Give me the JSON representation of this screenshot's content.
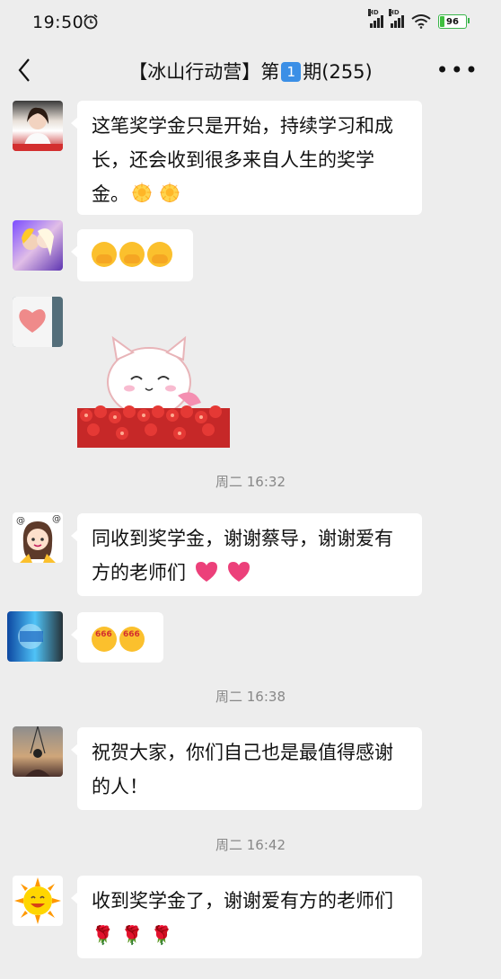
{
  "status_bar": {
    "time": "19:50",
    "battery": "96",
    "signal_label": "HD"
  },
  "header": {
    "title_prefix": "【冰山行动营】第",
    "issue_number": "1",
    "title_suffix": "期(255)"
  },
  "messages": [
    {
      "text": "这笔奖学金只是开始，持续学习和成长，还会收到很多来自人生的奖学金。"
    },
    {
      "text": ""
    },
    {
      "text": ""
    },
    {
      "text": "同收到奖学金，谢谢蔡导，谢谢爱有方的老师们"
    },
    {
      "text": ""
    },
    {
      "text": "祝贺大家，你们自己也是最值得感谢的人！"
    },
    {
      "text": "收到奖学金了，谢谢爱有方的老师们"
    }
  ],
  "timestamps": [
    "周二 16:32",
    "周二 16:38",
    "周二 16:42"
  ],
  "icons": [
    "back-icon",
    "more-icon",
    "alarm-icon",
    "sun-emoji",
    "hide-face-emoji",
    "heart-emoji",
    "rose-emoji"
  ],
  "colors": {
    "background": "#ededed",
    "bubble": "#ffffff",
    "accent": "#3b8fe6"
  }
}
